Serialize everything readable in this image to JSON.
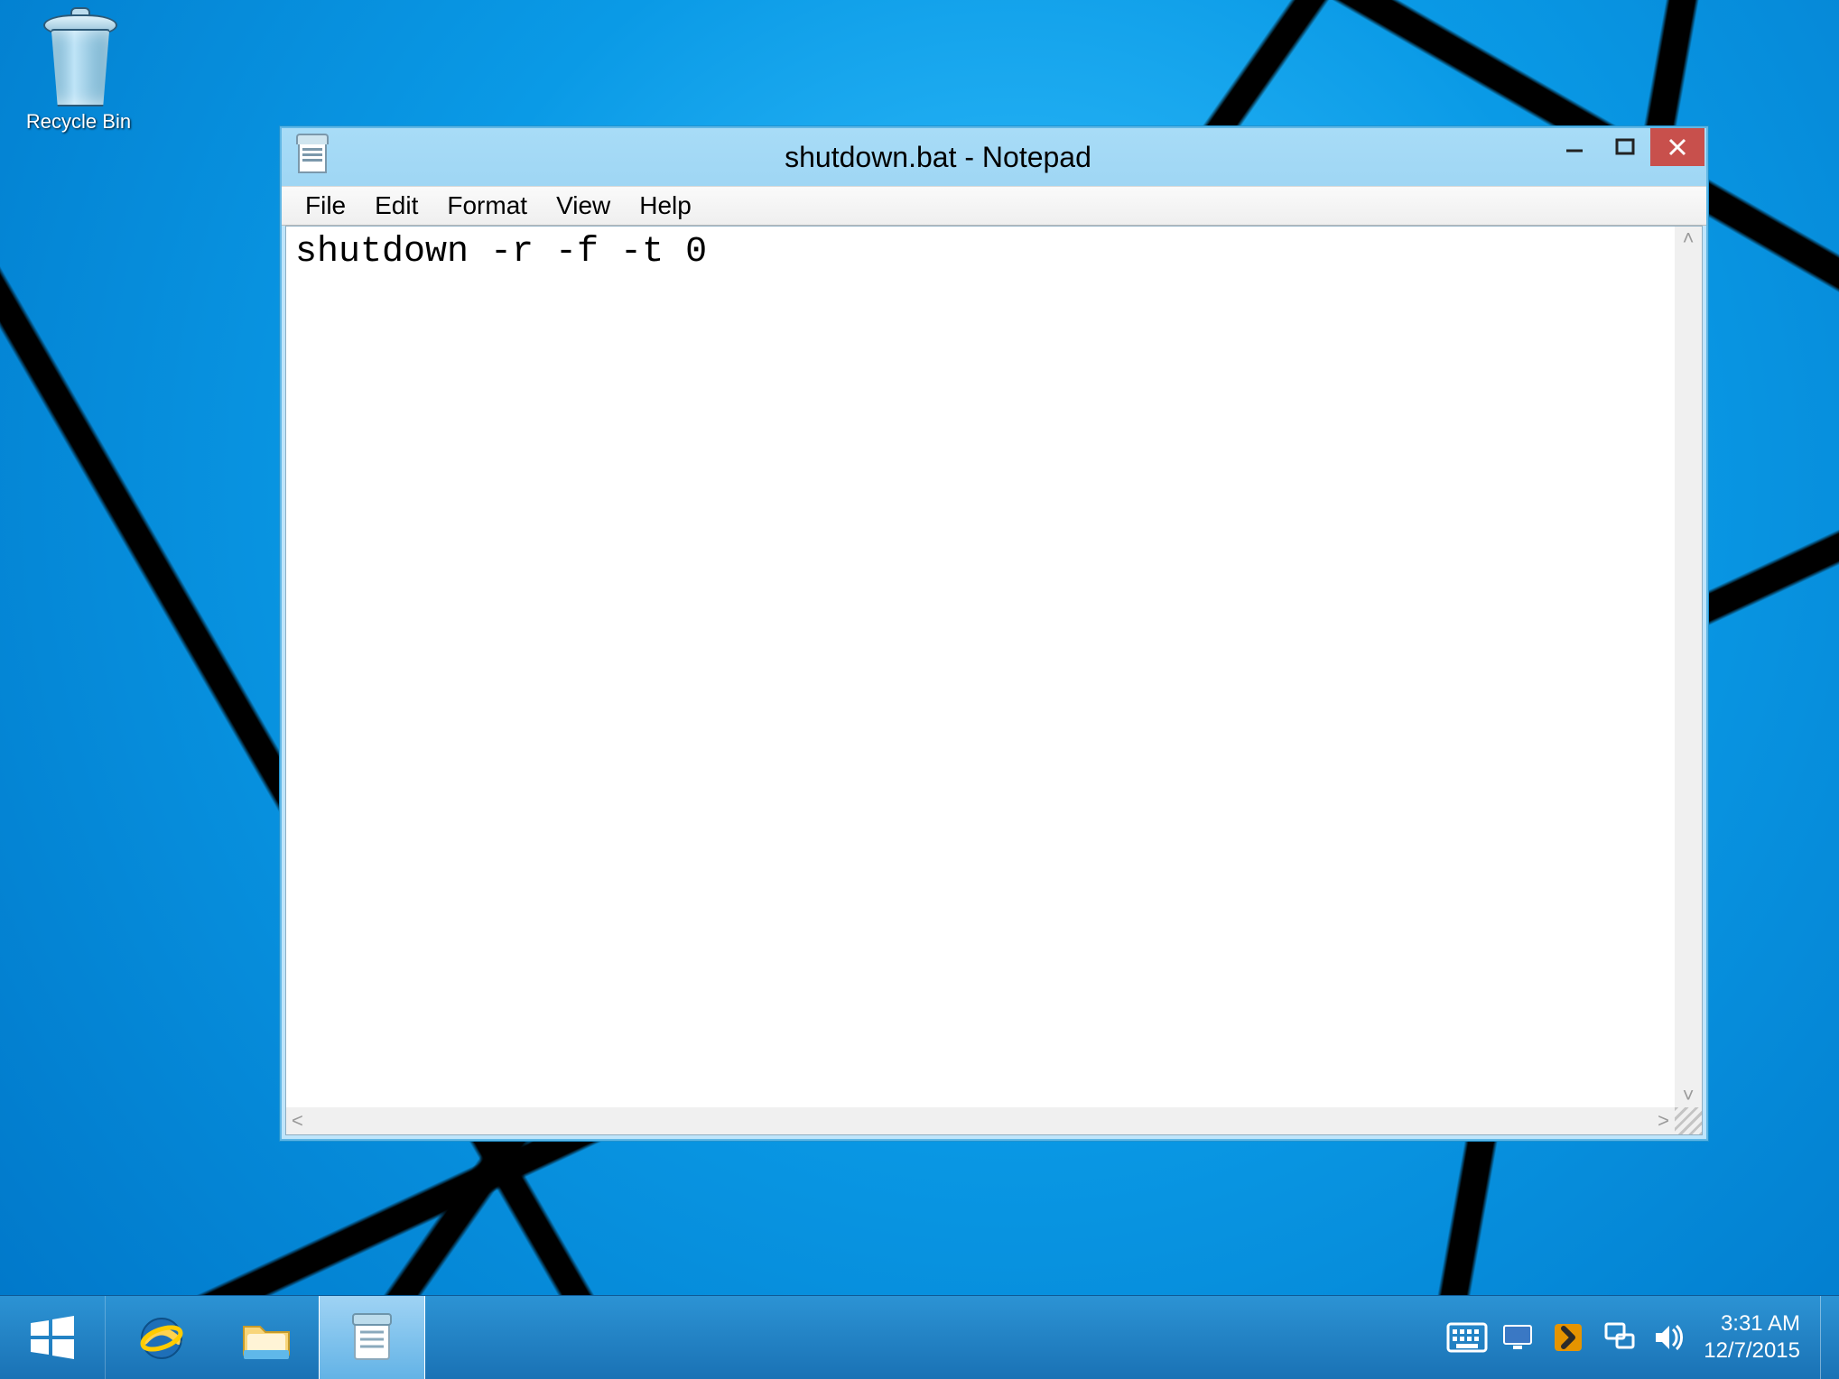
{
  "desktop": {
    "icons": [
      {
        "name": "recycle-bin",
        "label": "Recycle Bin"
      }
    ]
  },
  "window": {
    "app": "Notepad",
    "title": "shutdown.bat - Notepad",
    "menus": [
      "File",
      "Edit",
      "Format",
      "View",
      "Help"
    ],
    "content": "shutdown -r -f -t 0"
  },
  "taskbar": {
    "time": "3:31 AM",
    "date": "12/7/2015",
    "pinned": [
      {
        "name": "start",
        "label": "Start"
      },
      {
        "name": "internet-explorer",
        "label": "Internet Explorer"
      },
      {
        "name": "file-explorer",
        "label": "File Explorer"
      },
      {
        "name": "notepad",
        "label": "Notepad",
        "active": true
      }
    ],
    "tray": [
      {
        "name": "touch-keyboard"
      },
      {
        "name": "intel-graphics"
      },
      {
        "name": "plex"
      },
      {
        "name": "network"
      },
      {
        "name": "volume"
      }
    ]
  }
}
